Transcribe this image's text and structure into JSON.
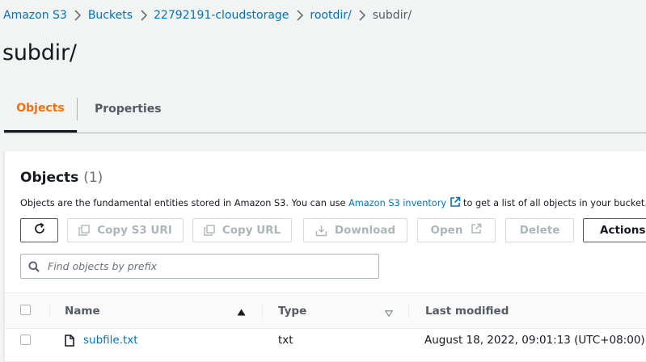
{
  "breadcrumb": {
    "items": [
      "Amazon S3",
      "Buckets",
      "22792191-cloudstorage",
      "rootdir/",
      "subdir/"
    ]
  },
  "page": {
    "title": "subdir/"
  },
  "tabs": [
    {
      "label": "Objects",
      "active": true
    },
    {
      "label": "Properties",
      "active": false
    }
  ],
  "objects_panel": {
    "title": "Objects",
    "count": "(1)",
    "description_pre": "Objects are the fundamental entities stored in Amazon S3. You can use",
    "description_link": "Amazon S3 inventory",
    "description_post": "to get a list of all objects in your bucket. For o",
    "toolbar": {
      "refresh_icon": "refresh-icon",
      "copy_s3_uri": "Copy S3 URI",
      "copy_url": "Copy URL",
      "download": "Download",
      "open": "Open",
      "delete": "Delete",
      "actions": "Actions"
    },
    "search": {
      "placeholder": "Find objects by prefix",
      "value": ""
    }
  },
  "table": {
    "columns": [
      "Name",
      "Type",
      "Last modified"
    ],
    "sort": {
      "column": "Name",
      "direction": "ascending"
    },
    "rows": [
      {
        "name": "subfile.txt",
        "type": "txt",
        "last_modified": "August 18, 2022, 09:01:13 (UTC+08:00)",
        "icon": "file-icon"
      }
    ]
  },
  "colors": {
    "link": "#0073bb",
    "active_tab": "#ec7211",
    "disabled_text": "#aab7b8",
    "background": "#f2f3f3"
  }
}
